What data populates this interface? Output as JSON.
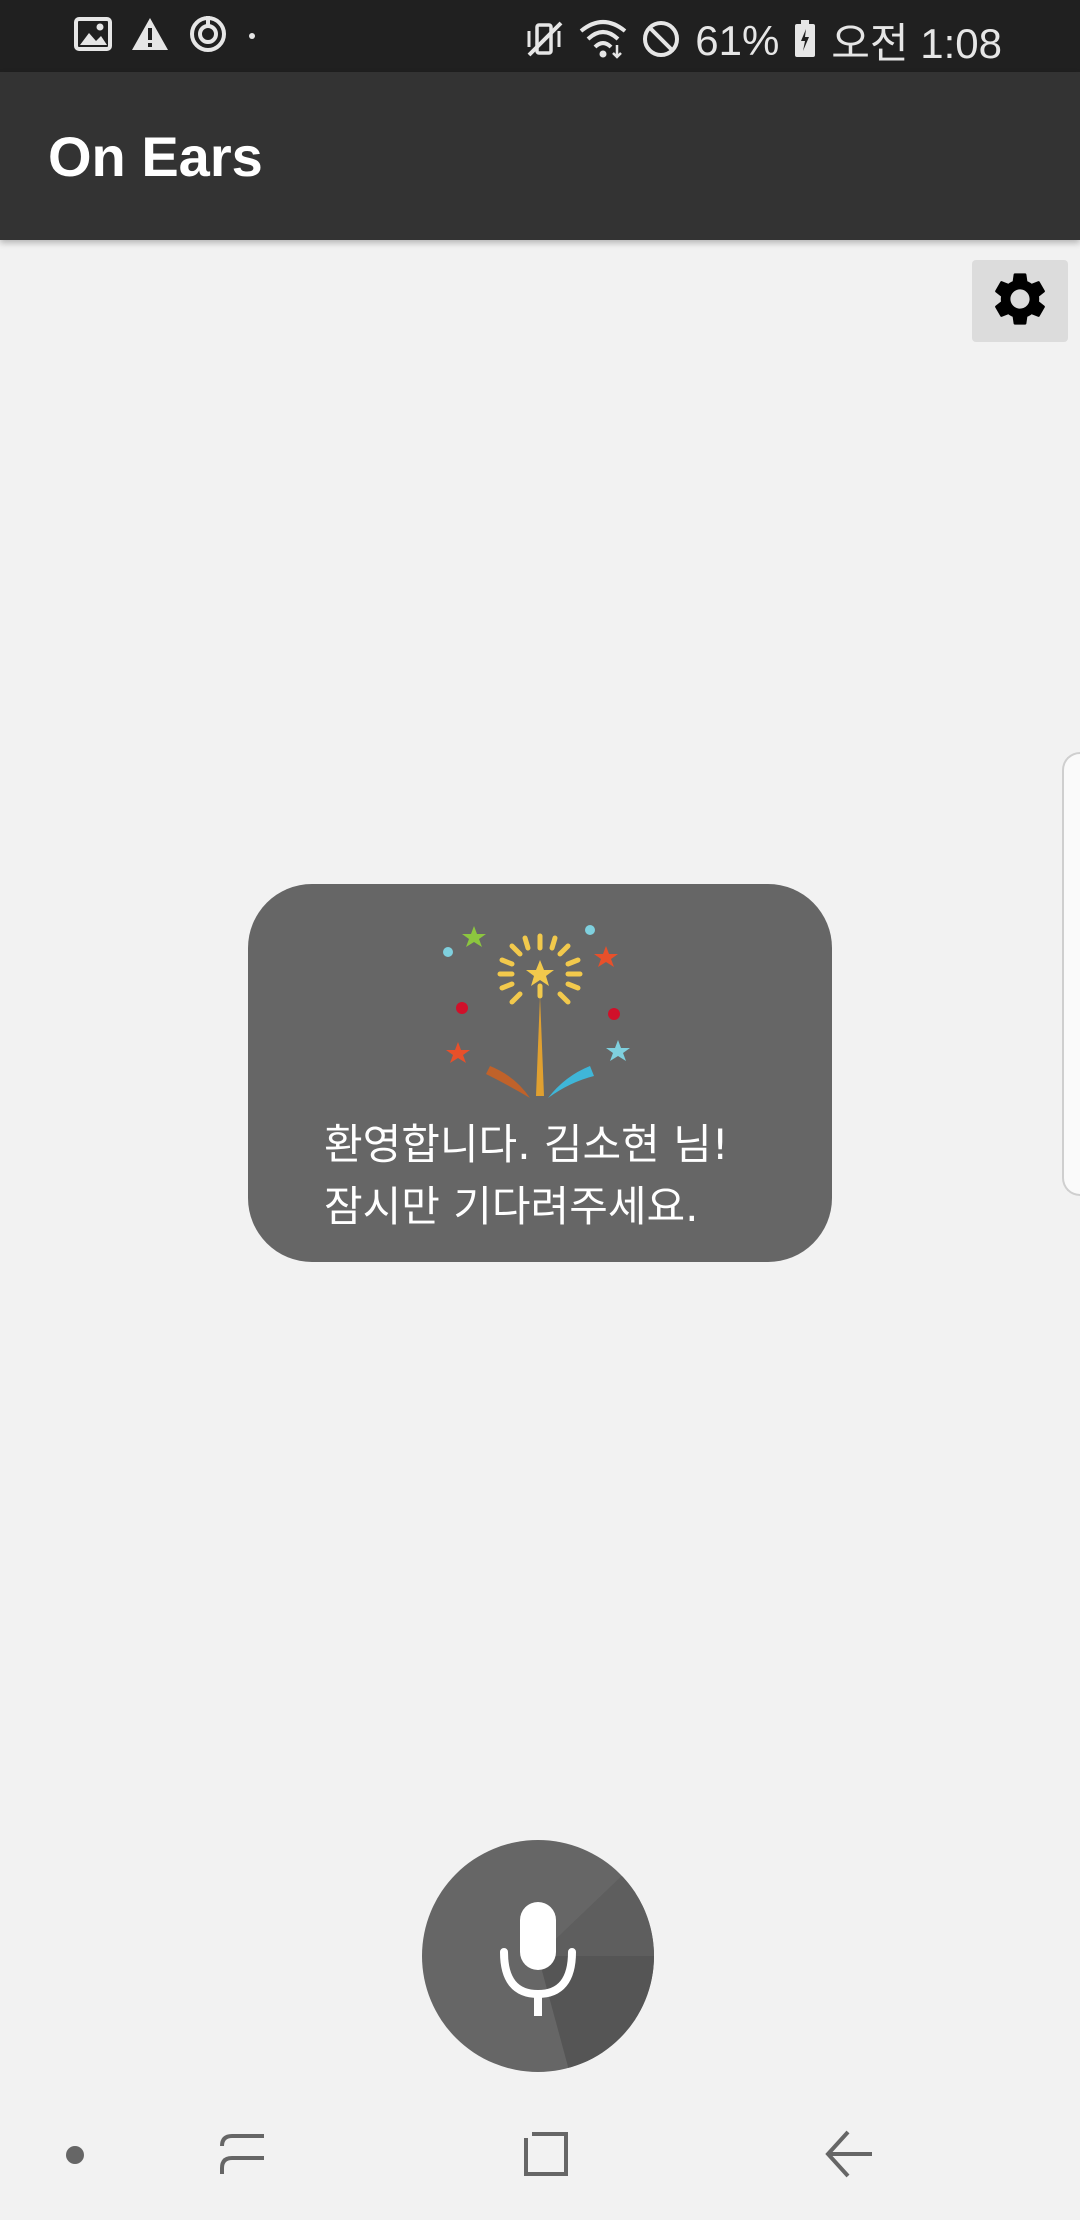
{
  "status_bar": {
    "left_icons": [
      "image-icon",
      "warning-icon",
      "sync-icon",
      "dot-icon"
    ],
    "right_icons": [
      "vibrate-mute-icon",
      "wifi-icon",
      "do-not-disturb-icon",
      "battery-icon"
    ],
    "battery": "61%",
    "time": "오전 1:08"
  },
  "app_bar": {
    "title": "On Ears"
  },
  "settings": {
    "icon": "gear-icon"
  },
  "toast": {
    "icon": "fireworks-icon",
    "line1": "환영합니다. 김소현 님!",
    "line2": "잠시만 기다려주세요."
  },
  "mic": {
    "icon": "microphone-icon"
  },
  "nav_bar": {
    "items": [
      "dot-icon",
      "recent-apps-icon",
      "home-icon",
      "back-icon"
    ]
  },
  "colors": {
    "status_bar": "#202020",
    "app_bar": "#333333",
    "background": "#f2f2f2",
    "toast": "#666666",
    "mic_button": "#666666"
  }
}
